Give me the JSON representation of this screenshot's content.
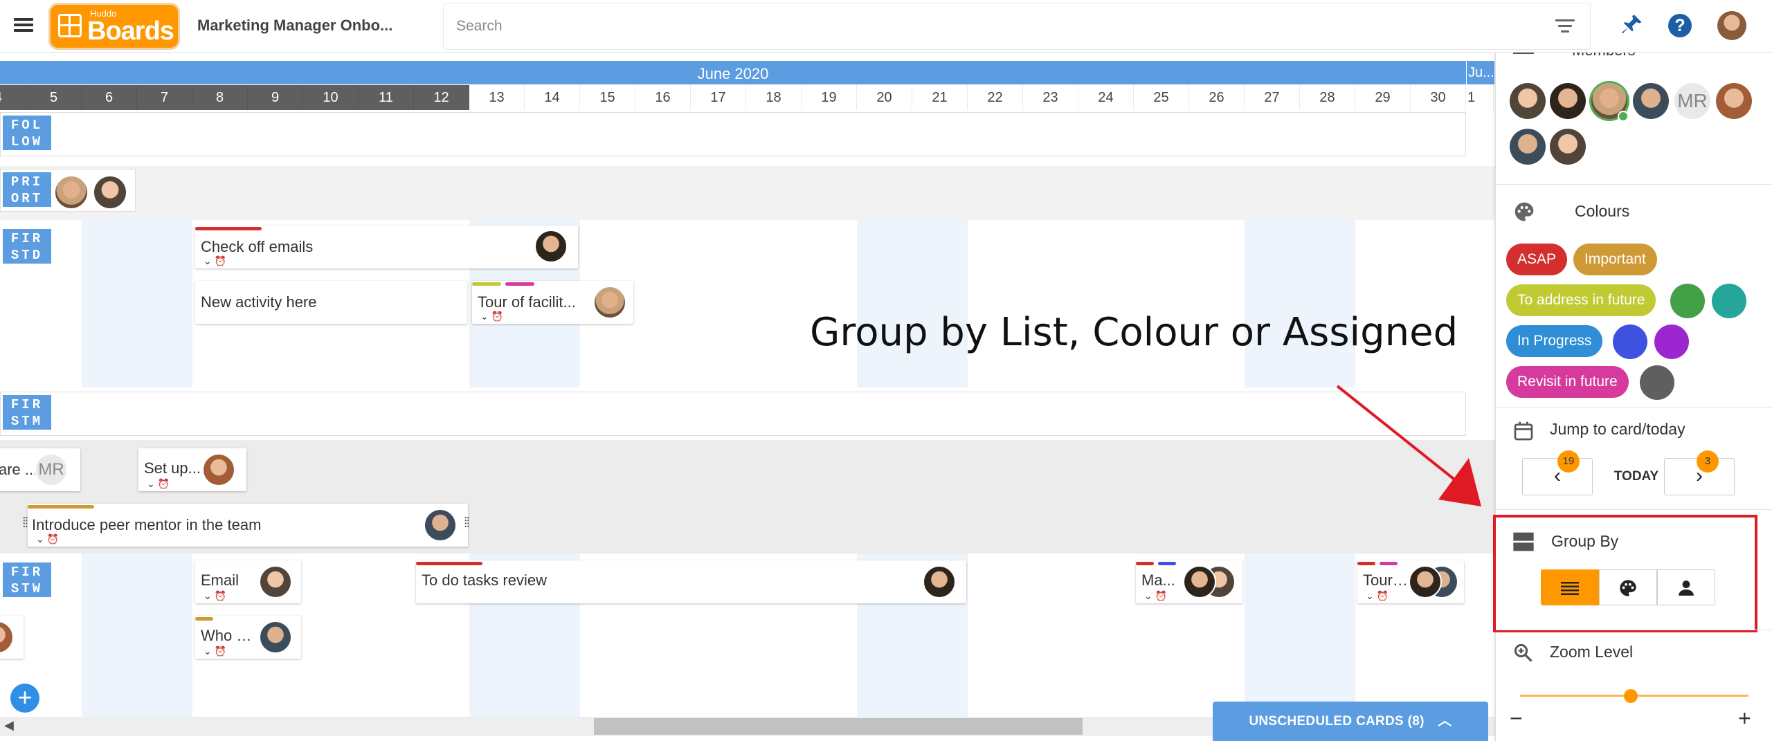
{
  "header": {
    "logo_small": "Huddo",
    "logo_text": "Boards",
    "board_title": "Marketing Manager Onbo...",
    "search_placeholder": "Search"
  },
  "timeline": {
    "month": "June 2020",
    "next_month": "Ju...",
    "left_edge_day": "4",
    "right_edge_day": "1",
    "days": [
      "5",
      "6",
      "7",
      "8",
      "9",
      "10",
      "11",
      "12",
      "13",
      "14",
      "15",
      "16",
      "17",
      "18",
      "19",
      "20",
      "21",
      "22",
      "23",
      "24",
      "25",
      "26",
      "27",
      "28",
      "29",
      "30"
    ],
    "past_days_count": 8
  },
  "lanes": [
    {
      "label": "FOL LOW"
    },
    {
      "label": "PRI ORT"
    },
    {
      "label": "FIR STD"
    },
    {
      "label": "FIR STM"
    },
    {
      "label": "FIR STW"
    }
  ],
  "cards": {
    "check_emails": "Check off emails",
    "new_activity": "New activity here",
    "tour_facility": "Tour of facilit...",
    "are": "are ...",
    "setup": "Set up...",
    "introduce": "Introduce peer mentor in the team",
    "email": "Email",
    "todo_review": "To do tasks review",
    "ma": "Ma...",
    "tour2": "Tour ...",
    "who": "Who a...",
    "mr_initials": "MR"
  },
  "overlay": {
    "text": "Group by List, Colour or Assigned"
  },
  "panel": {
    "members_title": "Members",
    "mr_initials": "MR",
    "colours_title": "Colours",
    "colour_labels": [
      {
        "label": "ASAP",
        "color": "#d32f2f"
      },
      {
        "label": "Important",
        "color": "#cf9a35"
      },
      {
        "label": "To address in future",
        "color": "#c0ca33"
      },
      {
        "label": "In Progress",
        "color": "#2f8ed6"
      },
      {
        "label": "Revisit in future",
        "color": "#d63a9c"
      }
    ],
    "colour_dots": [
      "#43a047",
      "#26a69a",
      "#3f51e0",
      "#9c27d0",
      "#5f5f5f"
    ],
    "jump_title": "Jump to card/today",
    "prev_count": "19",
    "today_label": "TODAY",
    "next_count": "3",
    "group_by_title": "Group By",
    "zoom_title": "Zoom Level",
    "zoom_minus": "−",
    "zoom_plus": "+"
  },
  "bottom": {
    "unscheduled_label": "UNSCHEDULED CARDS (8)",
    "add_label": "+"
  },
  "colors": {
    "accent_blue": "#5b9de0",
    "accent_orange": "#ff9800",
    "highlight_red": "#e01a24"
  }
}
